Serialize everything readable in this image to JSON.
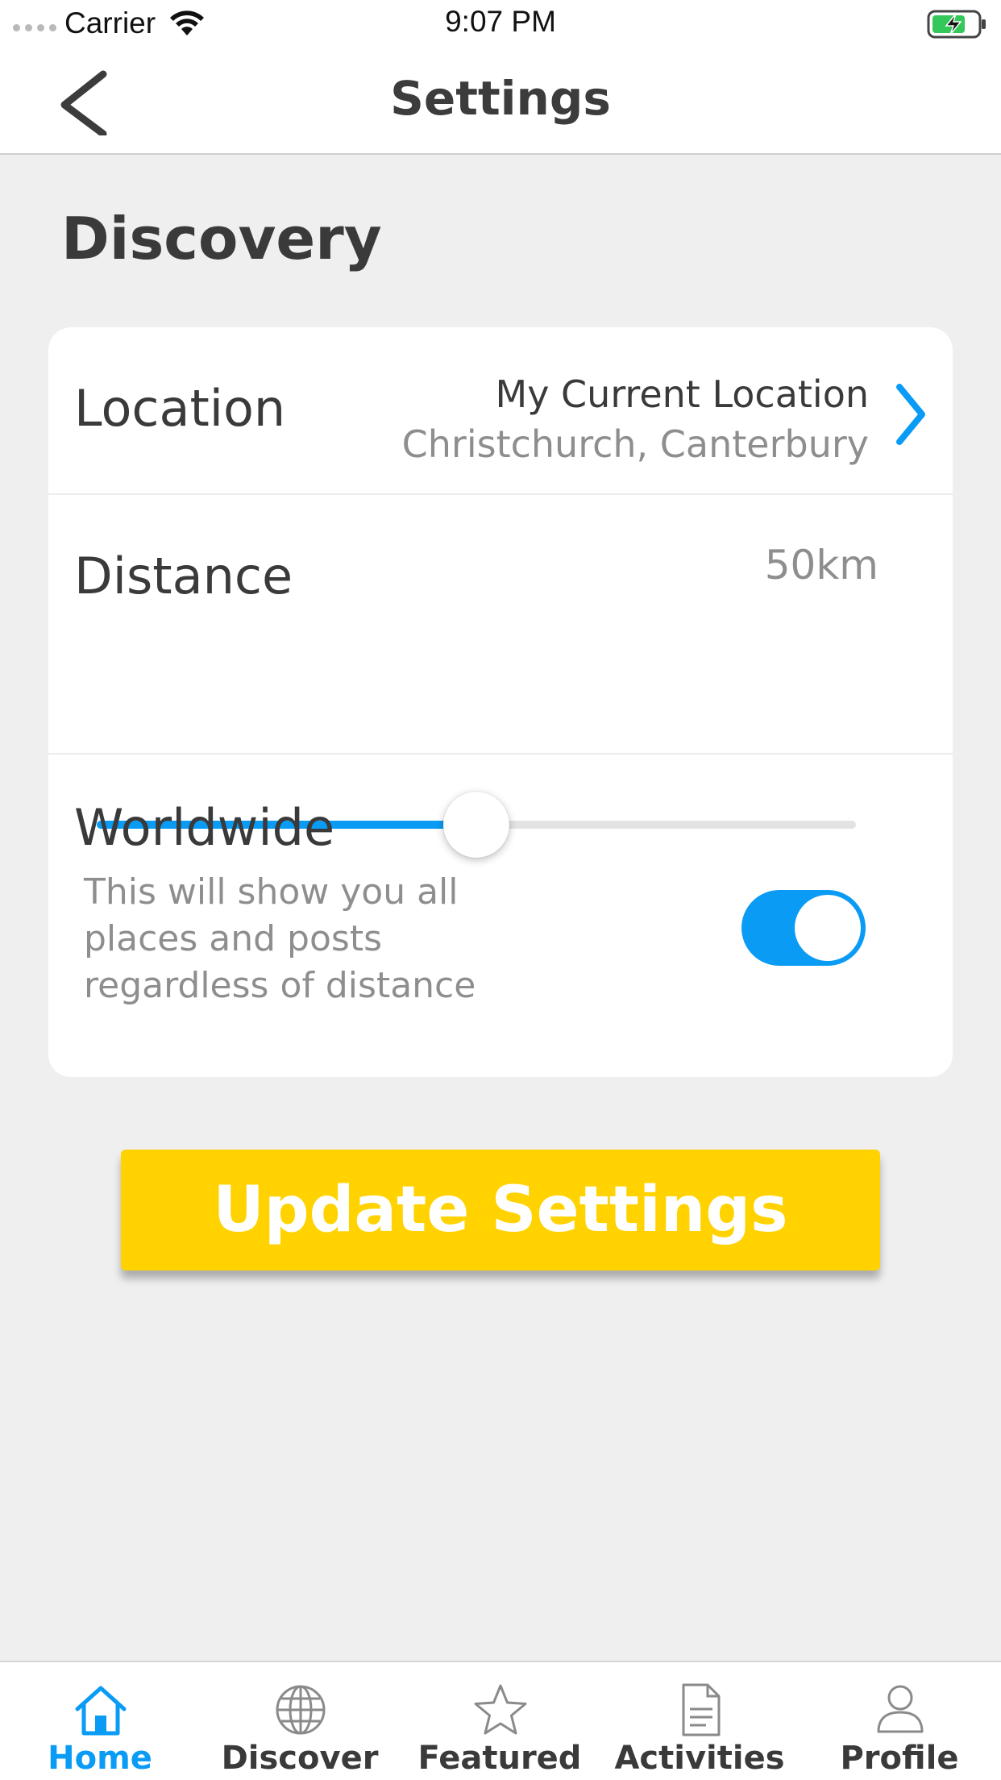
{
  "status_bar": {
    "carrier": "Carrier",
    "time": "9:07 PM"
  },
  "nav": {
    "title": "Settings",
    "back_icon": "chevron-left-icon"
  },
  "section": {
    "title": "Discovery"
  },
  "location": {
    "label": "Location",
    "primary": "My Current Location",
    "secondary": "Christchurch, Canterbury"
  },
  "distance": {
    "label": "Distance",
    "value": "50km",
    "slider_fraction": 0.5
  },
  "worldwide": {
    "label": "Worldwide",
    "description": "This will show you all places and posts regardless of distance",
    "enabled": true
  },
  "update_button": {
    "label": "Update Settings"
  },
  "tabs": [
    {
      "label": "Home",
      "icon": "home-icon",
      "active": true
    },
    {
      "label": "Discover",
      "icon": "globe-icon",
      "active": false
    },
    {
      "label": "Featured",
      "icon": "star-icon",
      "active": false
    },
    {
      "label": "Activities",
      "icon": "document-icon",
      "active": false
    },
    {
      "label": "Profile",
      "icon": "user-icon",
      "active": false
    }
  ],
  "colors": {
    "accent": "#0a9bf5",
    "button": "#ffd200",
    "background": "#efefef"
  }
}
